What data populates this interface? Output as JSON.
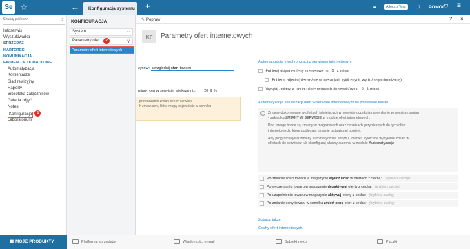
{
  "topbar": {
    "logo": "Se",
    "active_tab": "Konfiguracja systemu",
    "allegro": "Allegro Test",
    "help": "POMOC",
    "accent": "#1f6fa3"
  },
  "sidebar": {
    "search_placeholder": "Szukaj poleceń",
    "items": [
      {
        "label": "Infoserwis",
        "kind": "item"
      },
      {
        "label": "Wyszukiwarka",
        "kind": "item"
      },
      {
        "label": "SPRZEDAŻ",
        "kind": "header"
      },
      {
        "label": "KARTOTEKI",
        "kind": "header"
      },
      {
        "label": "KOMUNIKACJA",
        "kind": "header"
      },
      {
        "label": "EWIDENCJE DODATKOWE",
        "kind": "header"
      },
      {
        "label": "Automatyzacja",
        "kind": "sub"
      },
      {
        "label": "Komentarze",
        "kind": "sub"
      },
      {
        "label": "Ślad rewizyjny",
        "kind": "sub"
      },
      {
        "label": "Raporty",
        "kind": "sub"
      },
      {
        "label": "Biblioteka załączników",
        "kind": "sub"
      },
      {
        "label": "Galeria zdjęć",
        "kind": "sub"
      },
      {
        "label": "Notes",
        "kind": "sub"
      },
      {
        "label": "Konfiguracja",
        "kind": "sub-active",
        "badge": "1"
      },
      {
        "label": "Laboratorium",
        "kind": "sub"
      }
    ],
    "footer": "MOJE PRODUKTY"
  },
  "config": {
    "title": "KONFIGURACJA",
    "select_value": "System",
    "search_value": "Parametry ofe",
    "search_badge": "2",
    "result": "Parametry ofert internetowych"
  },
  "main": {
    "toolbar_edit": "Popraw",
    "kf": "KF",
    "title": "Parametry ofert internetowych",
    "left": {
      "row1_label": "zynów:",
      "row1_value_pre": "uwzględnij",
      "row1_value_bold": "stan",
      "row1_value_post": "towaru",
      "row2_label": "miany cen w serwisie, większe niż:",
      "row2_value": "20",
      "row2_unit": "%",
      "warn_line1": "prowadzanie zmian cen w serwisie",
      "warn_line2": "h zmian cen, które mogą pojawić się w cenniku"
    },
    "sync": {
      "title": "Automatyzacja synchronizacji z serwisem internetowym",
      "row1_pre": "Pobieraj aktywne oferty internetowe co",
      "row1_value": "5",
      "row1_unit": "minut",
      "row2": "Pobieraj zdjęcia (niezależnie w operacjach cyklicznych, wydłuża synchronizację)",
      "row3_pre": "Wysyłaj zmiany w ofertach internetowych do serwisów co",
      "row3_value": "5",
      "row3_unit": "minut"
    },
    "update": {
      "title": "Automatyzacja aktualizacji ofert w serwisie internetowym na podstawie towaru",
      "p1_a": "Zmiany dokonywane w ofertach istniejących w serwisie oczekują na wysłanie w rejestrze zmian",
      "p1_b": "- zakładka",
      "p1_bold1": "ZMIANY W SERWISIE",
      "p1_c": "w module ofert internetowych.",
      "p2_a": "Pod uwagę brane są zmiany w magazynach oraz cennikach przypisanych do tych ofert",
      "p2_b": "internetowych, które podlegają zmianie ustawionej poniżej.",
      "p3_a": "Aby program wysłał zmiany automatycznie, aktywuj również cykliczne wysyłanie zmian w",
      "p3_b": "ofertach do serwisów lub skonfiguruj własny automat w module",
      "p3_bold": "Automatyzacja",
      "rows": [
        {
          "pre": "Po zmianie ilości towaru w magazynie",
          "bold": "wylicz ilość",
          "post": "w ofertach z cechą:",
          "sel": "(wybierz cechę)"
        },
        {
          "pre": "Po wyczerpaniu towaru w magazynie",
          "bold": "dezaktywuj",
          "post": "oferty z cechą:",
          "sel": "(wybierz cechę)"
        },
        {
          "pre": "Po uzupełnieniu towaru w magazynie",
          "bold": "aktywuj",
          "post": "oferty z cechą:",
          "sel": "(wybierz cechę)"
        },
        {
          "pre": "Po zmianie ceny towaru w cenniku",
          "bold": "zmień cenę",
          "post": "ofert z cechą:",
          "sel": "(wybierz cechę)"
        }
      ]
    },
    "see_also": "Zobacz także",
    "see_link": "Cechy ofert internetowych"
  },
  "bottombar": {
    "items": [
      "Platforma sprzedaży",
      "Wiadomości e-mail",
      "Subiekt nexo",
      "Paczki"
    ]
  }
}
